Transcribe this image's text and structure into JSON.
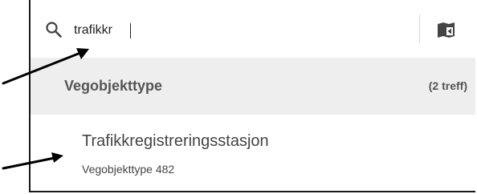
{
  "search": {
    "value": "trafikkr",
    "icon": "search-icon"
  },
  "toolbar": {
    "map_icon": "map-icon"
  },
  "section": {
    "title": "Vegobjekttype",
    "count": "(2 treff)"
  },
  "results": [
    {
      "title": "Trafikkregistreringsstasjon",
      "subtitle": "Vegobjekttype 482"
    }
  ],
  "annotation": {
    "arrow_color": "#000000"
  }
}
